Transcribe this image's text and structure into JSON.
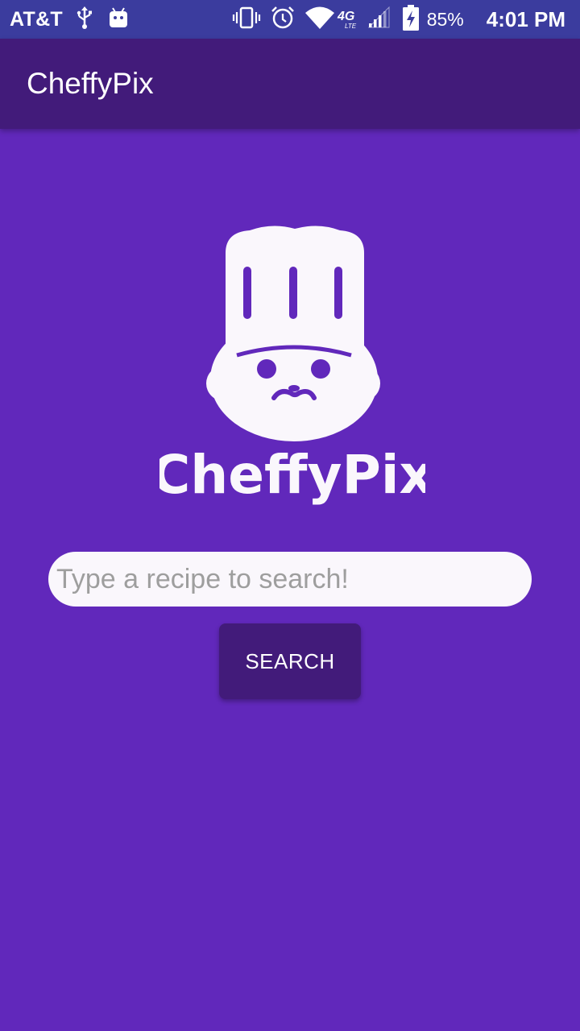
{
  "status_bar": {
    "carrier": "AT&T",
    "network": "4G",
    "network_sub": "LTE",
    "battery_percent": "85%",
    "time": "4:01 PM",
    "icons": [
      "usb-icon",
      "android-icon",
      "vibrate-icon",
      "alarm-icon",
      "wifi-icon",
      "lte-icon",
      "signal-icon",
      "battery-charging-icon"
    ]
  },
  "app_bar": {
    "title": "CheffyPix"
  },
  "logo": {
    "wordmark": "CheffyPix"
  },
  "search": {
    "placeholder": "Type a recipe to search!",
    "value": "",
    "button_label": "SEARCH"
  },
  "colors": {
    "status_bar": "#3B3C9E",
    "app_bar": "#421B7A",
    "background": "#6128BB",
    "input_background": "#FAF7FC",
    "button": "#421B7A"
  }
}
